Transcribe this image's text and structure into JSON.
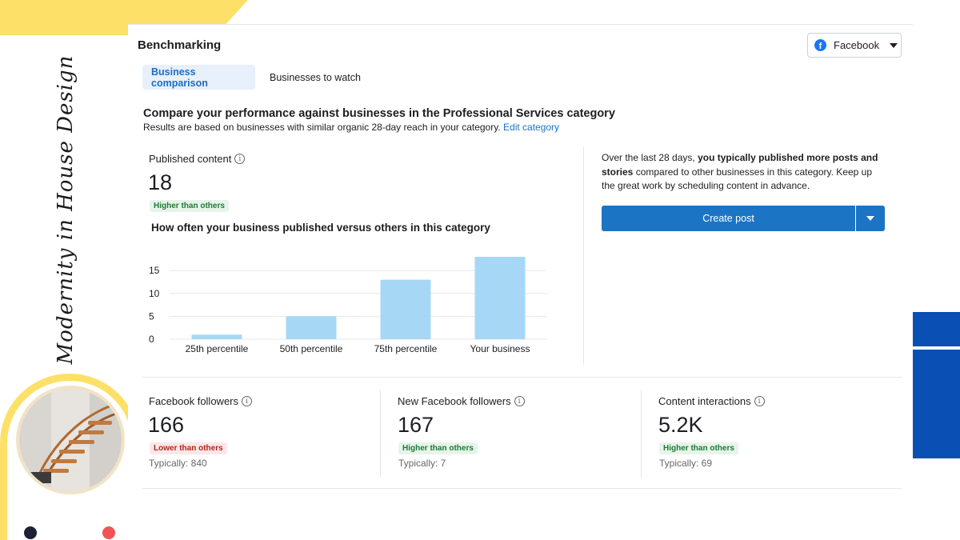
{
  "decor": {
    "vertical_text": "Modernity in House Design"
  },
  "colors": {
    "accent_yellow": "#fde068",
    "brand_blue": "#0a4fb4",
    "facebook_blue": "#1877f2",
    "button_blue": "#1b74c4",
    "bar_blue": "#a6d8f5"
  },
  "header": {
    "title": "Benchmarking",
    "platform_select": {
      "icon": "facebook-icon",
      "value": "Facebook"
    }
  },
  "tabs": [
    {
      "label": "Business comparison",
      "active": true
    },
    {
      "label": "Businesses to watch",
      "active": false
    }
  ],
  "intro": {
    "heading": "Compare your performance against businesses in the Professional Services category",
    "subtext": "Results are based on businesses with similar organic 28-day reach in your category.",
    "link": "Edit category"
  },
  "published": {
    "label": "Published content",
    "value": "18",
    "badge": "Higher than others",
    "chart_title": "How often your business published versus others in this category"
  },
  "insight": {
    "prefix": "Over the last 28 days,",
    "bold": "you typically published more posts and stories",
    "suffix": "compared to other businesses in this category. Keep up the great work by scheduling content in advance.",
    "button": "Create post"
  },
  "metrics": [
    {
      "label": "Facebook followers",
      "value": "166",
      "badge": "Lower than others",
      "badge_type": "red",
      "typical": "Typically: 840"
    },
    {
      "label": "New Facebook followers",
      "value": "167",
      "badge": "Higher than others",
      "badge_type": "green",
      "typical": "Typically: 7"
    },
    {
      "label": "Content interactions",
      "value": "5.2K",
      "badge": "Higher than others",
      "badge_type": "green",
      "typical": "Typically: 69"
    }
  ],
  "chart_data": {
    "type": "bar",
    "title": "How often your business published versus others in this category",
    "categories": [
      "25th percentile",
      "50th percentile",
      "75th percentile",
      "Your business"
    ],
    "values": [
      1,
      5,
      13,
      18
    ],
    "yticks": [
      "0",
      "5",
      "10",
      "15"
    ],
    "ylim": [
      0,
      18
    ],
    "grid": true,
    "xlabel": "",
    "ylabel": ""
  }
}
